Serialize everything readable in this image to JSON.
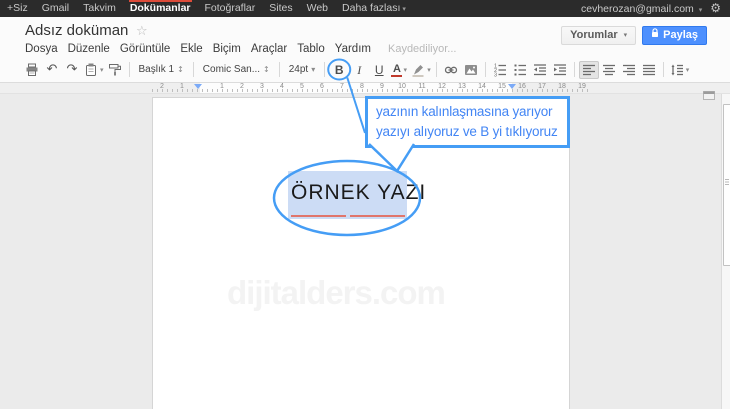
{
  "topbar": {
    "items": [
      {
        "label": "+Siz",
        "name": "plus-you"
      },
      {
        "label": "Gmail",
        "name": "gmail"
      },
      {
        "label": "Takvim",
        "name": "calendar"
      },
      {
        "label": "Dokümanlar",
        "name": "documents",
        "active": true
      },
      {
        "label": "Fotoğraflar",
        "name": "photos"
      },
      {
        "label": "Sites",
        "name": "sites"
      },
      {
        "label": "Web",
        "name": "web"
      },
      {
        "label": "Daha fazlası",
        "name": "more",
        "caret": true
      }
    ],
    "account": "cevherozan@gmail.com",
    "account_caret": "▾",
    "gear_glyph": "⚙",
    "active_underline_color": "#dd4b39"
  },
  "header": {
    "title": "Adsız doküman",
    "star_glyph": "☆",
    "saving_status": "Kaydediliyor...",
    "comments_label": "Yorumlar",
    "comments_caret": "▾",
    "share_label": "Paylaş",
    "menu": [
      {
        "label": "Dosya",
        "name": "file"
      },
      {
        "label": "Düzenle",
        "name": "edit"
      },
      {
        "label": "Görüntüle",
        "name": "view"
      },
      {
        "label": "Ekle",
        "name": "insert"
      },
      {
        "label": "Biçim",
        "name": "format"
      },
      {
        "label": "Araçlar",
        "name": "tools"
      },
      {
        "label": "Tablo",
        "name": "table"
      },
      {
        "label": "Yardım",
        "name": "help"
      }
    ]
  },
  "toolbar": {
    "items": [
      {
        "kind": "icon",
        "name": "print",
        "icon": "printer"
      },
      {
        "kind": "glyph",
        "name": "undo",
        "glyph": "↶"
      },
      {
        "kind": "glyph",
        "name": "redo",
        "glyph": "↷"
      },
      {
        "kind": "icon",
        "name": "web-clipboard",
        "icon": "clipboard",
        "caret": true
      },
      {
        "kind": "icon",
        "name": "paint-format",
        "icon": "paint"
      },
      {
        "kind": "sep"
      },
      {
        "kind": "select",
        "name": "styles",
        "label": "Başlık 1",
        "arrow": "↕"
      },
      {
        "kind": "sep"
      },
      {
        "kind": "select",
        "name": "font-family",
        "label": "Comic San...",
        "arrow": "↕"
      },
      {
        "kind": "sep"
      },
      {
        "kind": "select",
        "name": "font-size",
        "label": "24pt",
        "arrow": "▾"
      },
      {
        "kind": "sep"
      },
      {
        "kind": "text",
        "name": "bold",
        "label": "B",
        "style": "b"
      },
      {
        "kind": "text",
        "name": "italic",
        "label": "I",
        "style": "i"
      },
      {
        "kind": "text",
        "name": "underline",
        "label": "U",
        "style": "u"
      },
      {
        "kind": "acolor",
        "name": "text-color",
        "label": "A",
        "caret": true
      },
      {
        "kind": "icon",
        "name": "highlight-color",
        "icon": "highlighter",
        "caret": true
      },
      {
        "kind": "sep"
      },
      {
        "kind": "icon",
        "name": "insert-link",
        "icon": "link"
      },
      {
        "kind": "icon",
        "name": "insert-image",
        "icon": "image"
      },
      {
        "kind": "sep"
      },
      {
        "kind": "icon",
        "name": "numbered-list",
        "icon": "numbered-list"
      },
      {
        "kind": "icon",
        "name": "bulleted-list",
        "icon": "bulleted-list"
      },
      {
        "kind": "icon",
        "name": "decrease-indent",
        "icon": "outdent"
      },
      {
        "kind": "icon",
        "name": "increase-indent",
        "icon": "indent"
      },
      {
        "kind": "sep"
      },
      {
        "kind": "icon",
        "name": "align-left",
        "icon": "align-left",
        "pressed": true
      },
      {
        "kind": "icon",
        "name": "align-center",
        "icon": "align-center"
      },
      {
        "kind": "icon",
        "name": "align-right",
        "icon": "align-right"
      },
      {
        "kind": "icon",
        "name": "align-justify",
        "icon": "align-justify"
      },
      {
        "kind": "sep"
      },
      {
        "kind": "icon",
        "name": "line-spacing",
        "icon": "line-spacing",
        "caret": true
      }
    ]
  },
  "ruler": {
    "numbers": [
      "2",
      "1",
      "1",
      "2",
      "3",
      "4",
      "5",
      "6",
      "7",
      "8",
      "9",
      "10",
      "11",
      "12",
      "13",
      "14",
      "15",
      "16",
      "17",
      "18",
      "19"
    ],
    "marker_color": "#7baaf7"
  },
  "doc": {
    "text": "ÖRNEK YAZI",
    "watermark": "dijitalders.com",
    "selection_color": "#ccdcf5",
    "spell_underline_color": "#e0756b"
  },
  "annotation": {
    "line1": "yazının kalınlaşmasına yarıyor",
    "line2": "yazıyı alıyoruz ve B yi tıklıyoruz",
    "color": "#459df5",
    "text_color": "#4285f4"
  }
}
